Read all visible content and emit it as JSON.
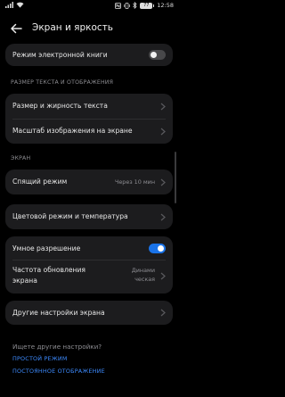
{
  "status": {
    "battery_text": "77",
    "time": "12:58"
  },
  "header": {
    "title": "Экран и яркость"
  },
  "rows": {
    "ebook_mode": "Режим электронной книги",
    "text_size": "Размер и жирность текста",
    "zoom": "Масштаб изображения на экране",
    "sleep": "Спящий режим",
    "sleep_value": "Через 10 мин",
    "color_mode": "Цветовой режим и температура",
    "smart_res": "Умное разрешение",
    "refresh_line1": "Частота обновления",
    "refresh_line2": "экрана",
    "refresh_value_line1": "Динами",
    "refresh_value_line2": "ческая",
    "other": "Другие настройки экрана"
  },
  "sections": {
    "text_display": "РАЗМЕР ТЕКСТА И ОТОБРАЖЕНИЯ",
    "screen": "ЭКРАН"
  },
  "toggles": {
    "ebook_mode": false,
    "smart_res": true
  },
  "footer": {
    "question": "Ищете другие настройки?",
    "link1": "ПРОСТОЙ РЕЖИМ",
    "link2": "ПОСТОЯННОЕ ОТОБРАЖЕНИЕ"
  },
  "colors": {
    "accent": "#1a73e8",
    "link": "#3d8bff"
  },
  "icons": [
    "wifi-icon",
    "signal-icon",
    "battery-icon",
    "back-arrow-icon",
    "chevron-right-icon"
  ]
}
